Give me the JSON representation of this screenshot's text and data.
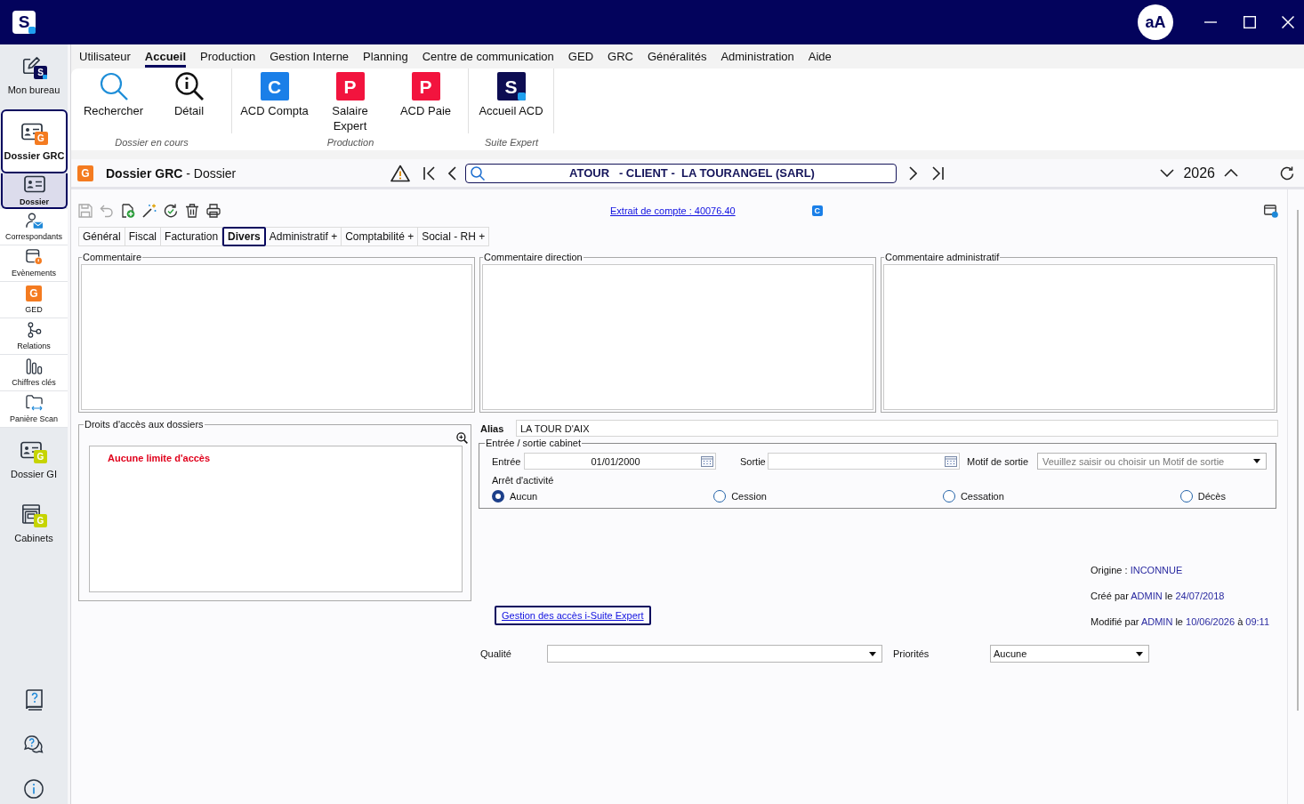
{
  "window": {
    "logo": "S",
    "account": "aA"
  },
  "sidebar": {
    "items": [
      {
        "label": "Mon bureau",
        "selected": false,
        "badge": {
          "text": "S",
          "color": "#0b0b55"
        }
      },
      {
        "label": "Dossier GRC",
        "selected": true,
        "badge": {
          "text": "G",
          "color": "#f47b20"
        },
        "children": [
          {
            "label": "Dossier",
            "selected": true
          },
          {
            "label": "Correspondants",
            "selected": false
          },
          {
            "label": "Evènements",
            "selected": false
          },
          {
            "label": "GED",
            "selected": false,
            "badge": {
              "text": "G",
              "color": "#f47b20"
            }
          },
          {
            "label": "Relations",
            "selected": false
          },
          {
            "label": "Chiffres clés",
            "selected": false
          },
          {
            "label": "Panière Scan",
            "selected": false
          }
        ]
      },
      {
        "label": "Dossier GI",
        "selected": false,
        "badge": {
          "text": "G",
          "color": "#c6d400"
        }
      },
      {
        "label": "Cabinets",
        "selected": false,
        "badge": {
          "text": "G",
          "color": "#c6d400"
        }
      }
    ]
  },
  "menu": [
    {
      "label": "Utilisateur",
      "selected": false
    },
    {
      "label": "Accueil",
      "selected": true
    },
    {
      "label": "Production",
      "selected": false
    },
    {
      "label": "Gestion Interne",
      "selected": false
    },
    {
      "label": "Planning",
      "selected": false
    },
    {
      "label": "Centre de communication",
      "selected": false
    },
    {
      "label": "GED",
      "selected": false
    },
    {
      "label": "GRC",
      "selected": false
    },
    {
      "label": "Généralités",
      "selected": false
    },
    {
      "label": "Administration",
      "selected": false
    },
    {
      "label": "Aide",
      "selected": false
    }
  ],
  "ribbon": {
    "groups": [
      {
        "label": "Dossier en cours",
        "buttons": [
          {
            "label": "Rechercher"
          },
          {
            "label": "Détail"
          }
        ]
      },
      {
        "label": "Production",
        "buttons": [
          {
            "label": "ACD Compta",
            "logo": {
              "text": "C",
              "color": "#1a7fe8"
            }
          },
          {
            "label": "Salaire Expert",
            "logo": {
              "text": "P",
              "color": "#f2143e"
            }
          },
          {
            "label": "ACD Paie",
            "logo": {
              "text": "P",
              "color": "#f2143e"
            }
          }
        ]
      },
      {
        "label": "Suite Expert",
        "buttons": [
          {
            "label": "Accueil ACD",
            "logo": {
              "text": "S",
              "color": "#0d0d52"
            }
          }
        ]
      }
    ]
  },
  "record_header": {
    "badge": {
      "text": "G",
      "color": "#f47b20"
    },
    "title": "**Dossier GRC** - Dossier",
    "search": {
      "value": "ATOUR   - CLIENT -  LA TOURANGEL (SARL)"
    },
    "year": "2026"
  },
  "toolbar": {
    "actions": [
      {
        "disabled": true
      },
      {
        "disabled": true
      },
      {
        "disabled": false
      },
      {
        "disabled": false
      },
      {
        "disabled": false
      },
      {
        "disabled": false
      },
      {
        "disabled": false
      }
    ],
    "account_link": "Extrait de compte : 40076.40",
    "badge": {
      "text": "C",
      "color": "#1a7fe8"
    }
  },
  "tabs": [
    {
      "label": "Général",
      "selected": false
    },
    {
      "label": "Fiscal",
      "selected": false
    },
    {
      "label": "Facturation",
      "selected": false
    },
    {
      "label": "Divers",
      "selected": true
    },
    {
      "label": "Administratif +",
      "selected": false
    },
    {
      "label": "Comptabilité +",
      "selected": false
    },
    {
      "label": "Social - RH +",
      "selected": false
    }
  ],
  "comment_panels": [
    {
      "title": "Commentaire"
    },
    {
      "title": "Commentaire direction"
    },
    {
      "title": "Commentaire administratif"
    }
  ],
  "access_rights": {
    "title": "Droits d'accès aux dossiers",
    "message": "Aucune limite d'accès"
  },
  "alias": {
    "label": "Alias",
    "value": "LA TOUR D'AIX"
  },
  "cabinet": {
    "title": "Entrée / sortie cabinet",
    "entry": {
      "label": "Entrée",
      "value": "01/01/2000"
    },
    "exit": {
      "label": "Sortie"
    },
    "exit_reason": {
      "label": "Motif de sortie",
      "placeholder": "Veuillez saisir ou choisir un Motif de sortie"
    },
    "activity_stop": {
      "label": "Arrêt d'activité",
      "options": [
        {
          "label": "Aucun",
          "selected": true
        },
        {
          "label": "Cession",
          "selected": false
        },
        {
          "label": "Cessation",
          "selected": false
        },
        {
          "label": "Décès",
          "selected": false
        }
      ]
    }
  },
  "access_link": {
    "label": "Gestion des accès i-Suite Expert",
    "focused": true
  },
  "audit": [
    {
      "parts": [
        {
          "text": "Origine : ",
          "kind": "label"
        },
        {
          "text": "INCONNUE",
          "kind": "value"
        }
      ]
    },
    {
      "parts": [
        {
          "text": "Créé par ",
          "kind": "label"
        },
        {
          "text": "ADMIN",
          "kind": "value"
        },
        {
          "text": " le ",
          "kind": "label"
        },
        {
          "text": "24/07/2018",
          "kind": "value"
        }
      ]
    },
    {
      "parts": [
        {
          "text": "Modifié par ",
          "kind": "label"
        },
        {
          "text": "ADMIN",
          "kind": "value"
        },
        {
          "text": " le ",
          "kind": "label"
        },
        {
          "text": "10/06/2026",
          "kind": "value"
        },
        {
          "text": " à ",
          "kind": "label"
        },
        {
          "text": "09:11",
          "kind": "value"
        }
      ]
    }
  ],
  "quality": {
    "label": "Qualité"
  },
  "priorities": {
    "label": "Priorités",
    "value": "Aucune"
  }
}
